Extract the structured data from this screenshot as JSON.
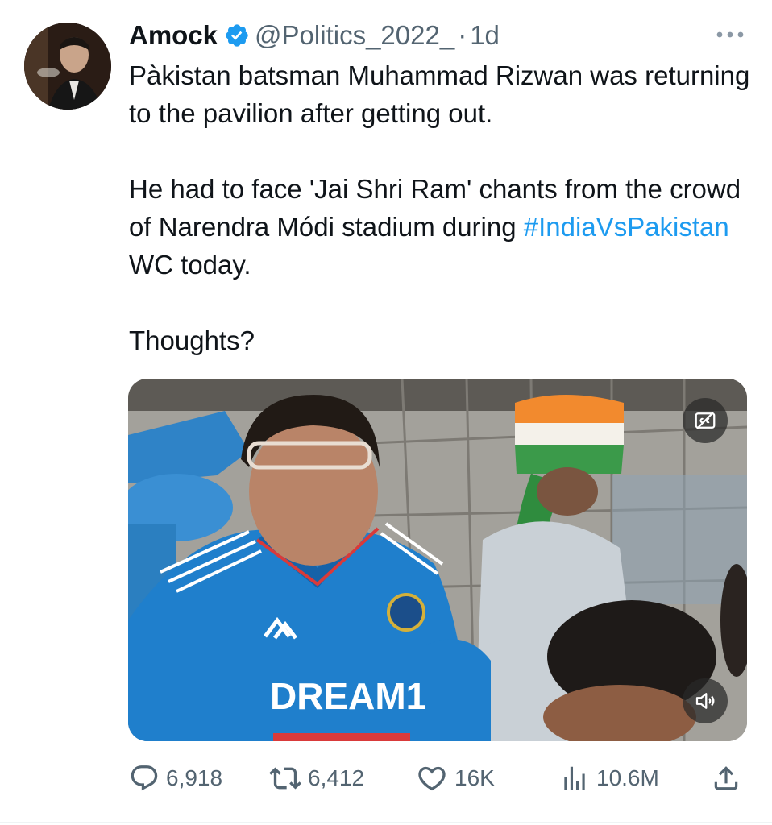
{
  "author": {
    "display_name": "Amock",
    "handle": "@Politics_2022_",
    "separator": "·",
    "time": "1d",
    "verified_color": "#1d9bf0"
  },
  "tweet": {
    "paragraphs": [
      "Pàkistan batsman Muhammad Rizwan was returning to the pavilion after getting out.",
      "He had to face 'Jai Shri Ram' chants from the crowd of Narendra Módi stadium during"
    ],
    "hashtag": "#IndiaVsPakistan",
    "after_hashtag": " WC today.",
    "closing": "Thoughts?",
    "link_color": "#1d9bf0"
  },
  "media": {
    "jersey_text": "DREAM11",
    "captions_icon": "captions-icon",
    "volume_icon": "volume-icon"
  },
  "actions": {
    "replies": "6,918",
    "retweets": "6,412",
    "likes": "16K",
    "views": "10.6M"
  }
}
